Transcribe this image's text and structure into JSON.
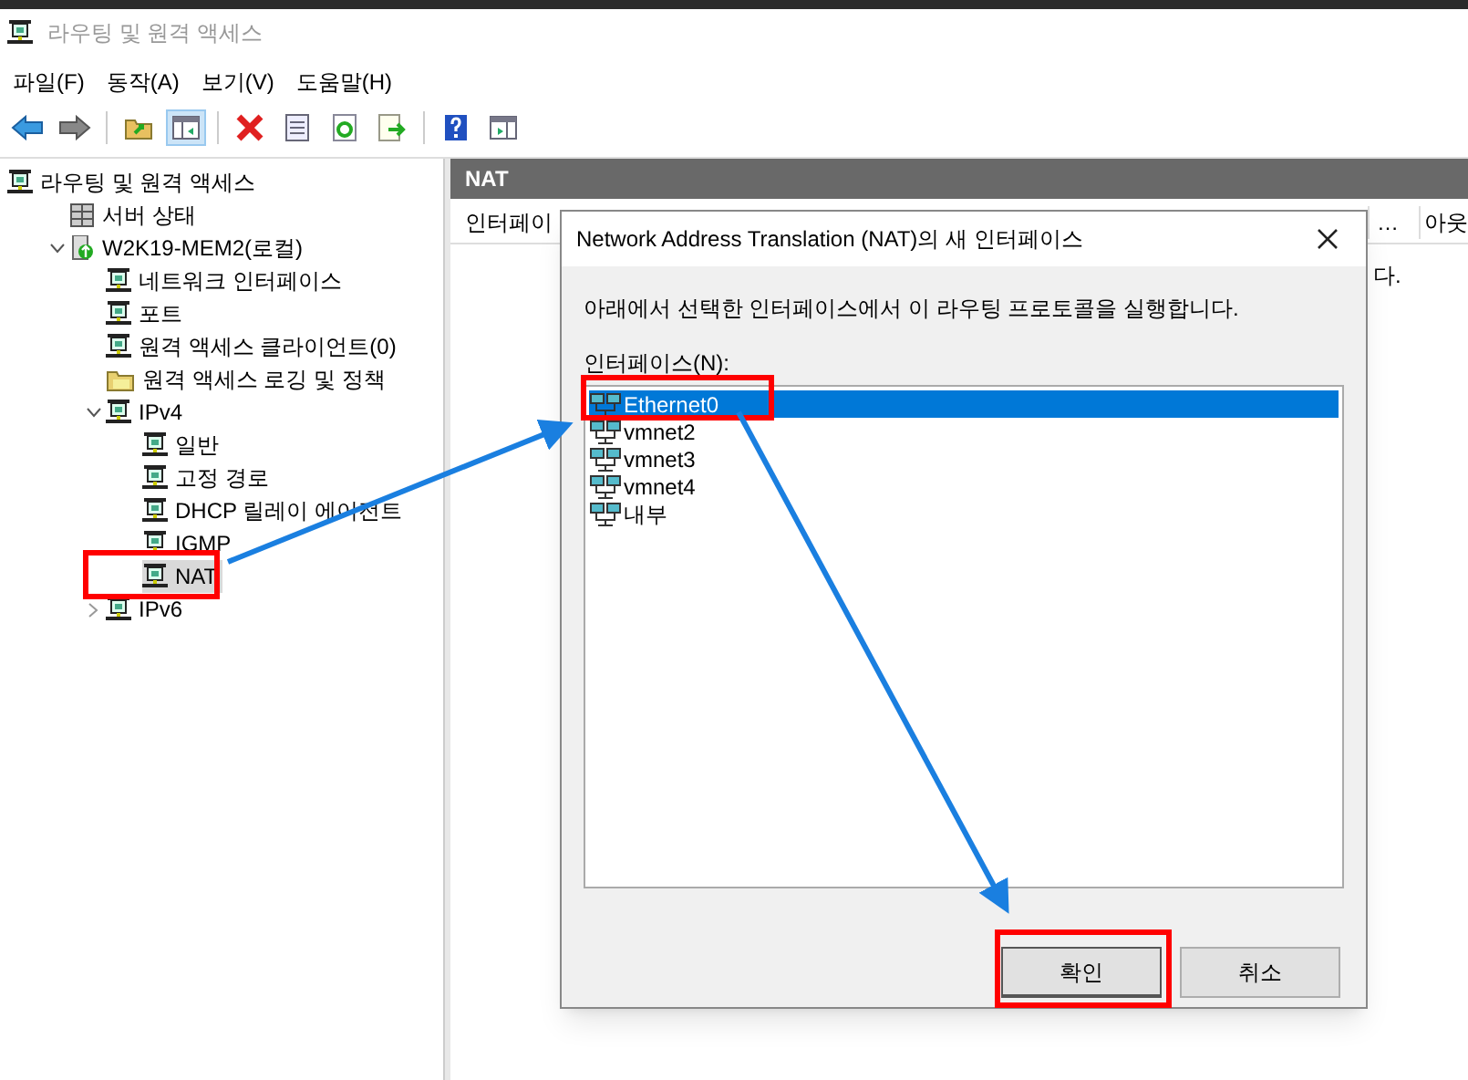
{
  "window": {
    "title": "라우팅 및 원격 액세스"
  },
  "menu": [
    "파일(F)",
    "동작(A)",
    "보기(V)",
    "도움말(H)"
  ],
  "toolbar": [
    {
      "kind": "back",
      "pressed": false
    },
    {
      "kind": "forward",
      "pressed": false
    },
    {
      "kind": "sep"
    },
    {
      "kind": "up",
      "pressed": false
    },
    {
      "kind": "pane",
      "pressed": true
    },
    {
      "kind": "sep"
    },
    {
      "kind": "delete",
      "pressed": false
    },
    {
      "kind": "properties",
      "pressed": false
    },
    {
      "kind": "refresh",
      "pressed": false
    },
    {
      "kind": "export",
      "pressed": false
    },
    {
      "kind": "sep"
    },
    {
      "kind": "help",
      "pressed": false
    },
    {
      "kind": "action-pane",
      "pressed": false
    }
  ],
  "tree": [
    {
      "label": "라우팅 및 원격 액세스",
      "kind": "node",
      "selected": false,
      "children": [
        {
          "label": "서버 상태",
          "kind": "server",
          "selected": false
        },
        {
          "label": "W2K19-MEM2(로컬)",
          "kind": "computer",
          "selected": false,
          "expanded": true,
          "children": [
            {
              "label": "네트워크 인터페이스",
              "kind": "node",
              "selected": false
            },
            {
              "label": "포트",
              "kind": "node",
              "selected": false
            },
            {
              "label": "원격 액세스 클라이언트(0)",
              "kind": "node",
              "selected": false
            },
            {
              "label": "원격 액세스 로깅 및 정책",
              "kind": "folder",
              "selected": false
            },
            {
              "label": "IPv4",
              "kind": "node",
              "selected": false,
              "expanded": true,
              "children": [
                {
                  "label": "일반",
                  "kind": "node",
                  "selected": false
                },
                {
                  "label": "고정 경로",
                  "kind": "node",
                  "selected": false
                },
                {
                  "label": "DHCP 릴레이 에이전트",
                  "kind": "node",
                  "selected": false
                },
                {
                  "label": "IGMP",
                  "kind": "node",
                  "selected": false
                },
                {
                  "label": "NAT",
                  "kind": "node",
                  "selected": true
                }
              ]
            },
            {
              "label": "IPv6",
              "kind": "node",
              "selected": false,
              "expanded": false
            }
          ]
        }
      ]
    }
  ],
  "content": {
    "title": "NAT",
    "columns": [
      "인터페이",
      "…",
      "아웃"
    ],
    "row_text": "다."
  },
  "dialog": {
    "title": "Network Address Translation (NAT)의 새 인터페이스",
    "description": "아래에서 선택한 인터페이스에서 이 라우팅 프로토콜을 실행합니다.",
    "list_label": "인터페이스(N):",
    "interfaces": [
      {
        "label": "Ethernet0",
        "selected": true
      },
      {
        "label": "vmnet2",
        "selected": false
      },
      {
        "label": "vmnet3",
        "selected": false
      },
      {
        "label": "vmnet4",
        "selected": false
      },
      {
        "label": "내부",
        "selected": false
      }
    ],
    "buttons": [
      {
        "label": "확인",
        "selected": true
      },
      {
        "label": "취소",
        "selected": false
      }
    ]
  }
}
